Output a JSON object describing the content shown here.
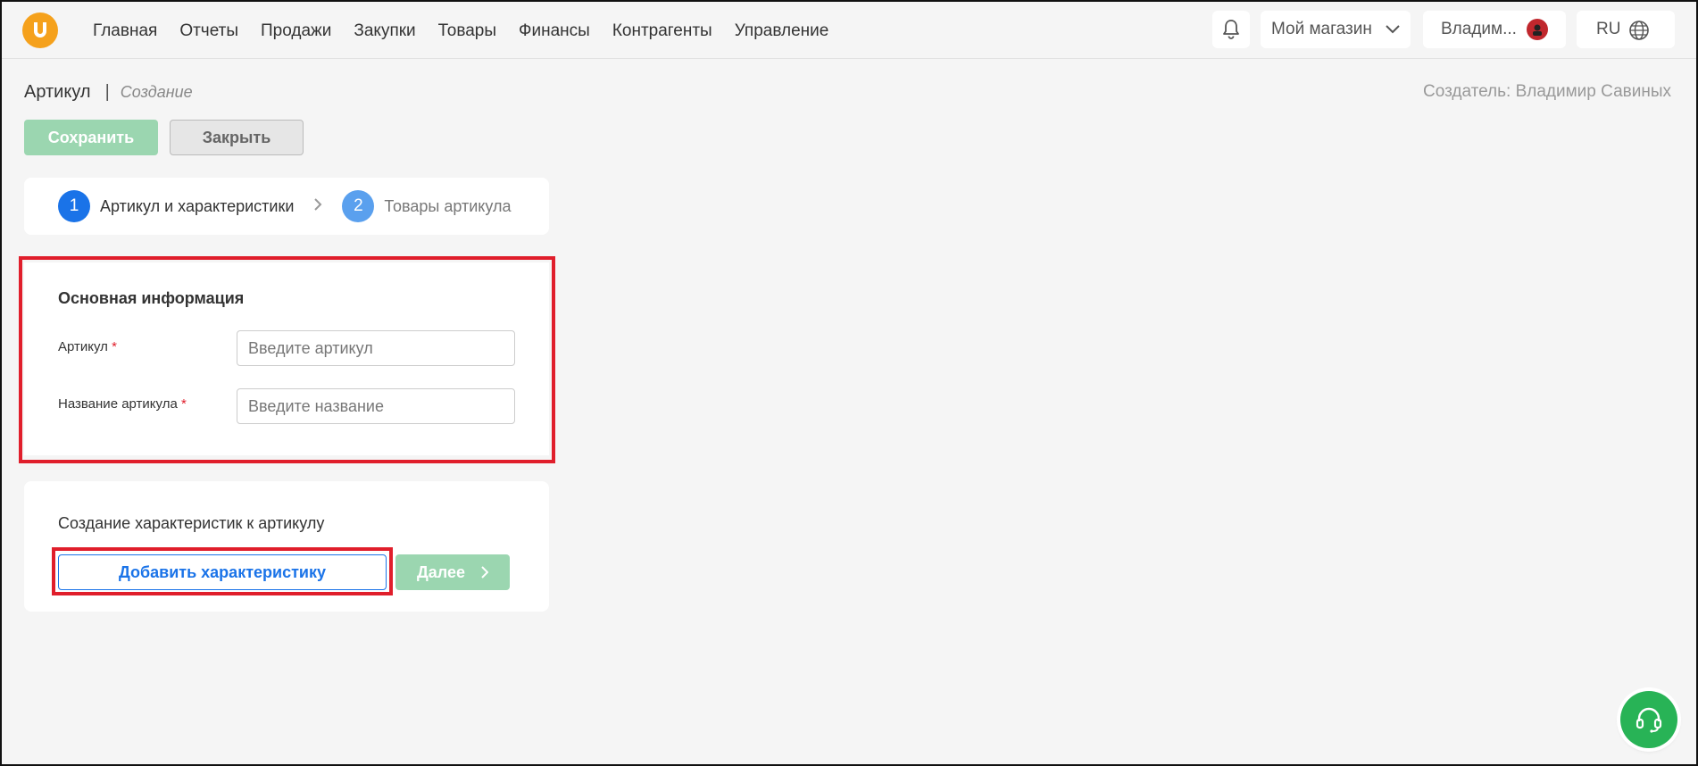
{
  "nav": {
    "items": [
      "Главная",
      "Отчеты",
      "Продажи",
      "Закупки",
      "Товары",
      "Финансы",
      "Контрагенты",
      "Управление"
    ]
  },
  "header": {
    "store": "Мой магазин",
    "user": "Владим...",
    "lang": "RU"
  },
  "page": {
    "title": "Артикул",
    "mode": "Создание",
    "creator": "Создатель: Владимир Савиных",
    "save_label": "Сохранить",
    "close_label": "Закрыть"
  },
  "stepper": {
    "steps": [
      {
        "num": "1",
        "label": "Артикул и характеристики"
      },
      {
        "num": "2",
        "label": "Товары артикула"
      }
    ]
  },
  "main_info": {
    "title": "Основная информация",
    "article_label": "Артикул",
    "article_placeholder": "Введите артикул",
    "article_value": "",
    "name_label": "Название артикула",
    "name_placeholder": "Введите название",
    "name_value": "",
    "required_mark": "*"
  },
  "characteristics": {
    "title": "Создание характеристик к артикулу",
    "add_label": "Добавить характеристику",
    "next_label": "Далее"
  },
  "colors": {
    "accent": "#1a73e8",
    "success_disabled": "#9bd6b0",
    "highlight": "#e01e2b",
    "logo": "#f5a11c",
    "support": "#28b356"
  },
  "icons": {
    "bell": "bell-icon",
    "dropdown": "chevron-down-icon",
    "globe": "globe-icon",
    "support": "headset-icon"
  }
}
